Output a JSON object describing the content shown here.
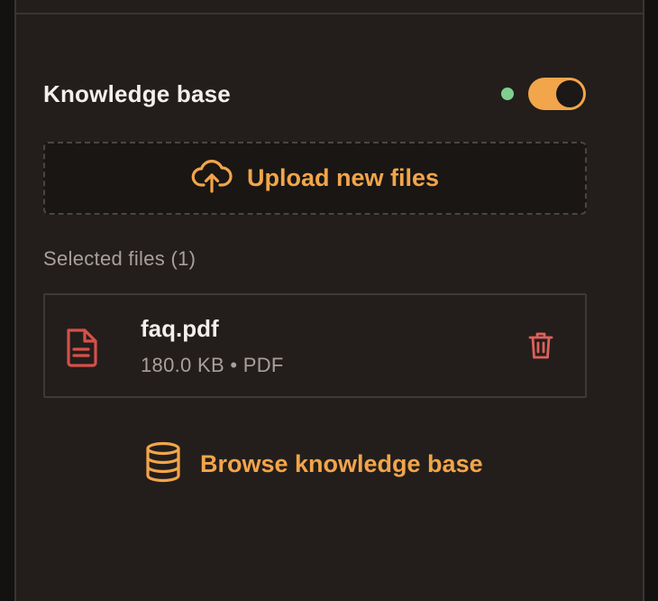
{
  "knowledge_base": {
    "title": "Knowledge base",
    "enabled": true,
    "status": "active"
  },
  "upload": {
    "label": "Upload new files",
    "icon": "cloud-upload-icon"
  },
  "selected_files": {
    "label": "Selected files (1)",
    "items": [
      {
        "name": "faq.pdf",
        "meta": "180.0 KB • PDF",
        "icon": "file-icon",
        "delete_icon": "trash-icon"
      }
    ]
  },
  "browse": {
    "label": "Browse knowledge base",
    "icon": "database-icon"
  },
  "colors": {
    "accent": "#f2a54a",
    "status_dot": "#7fcf8f",
    "danger": "#e0605a",
    "background": "#231e1c"
  }
}
